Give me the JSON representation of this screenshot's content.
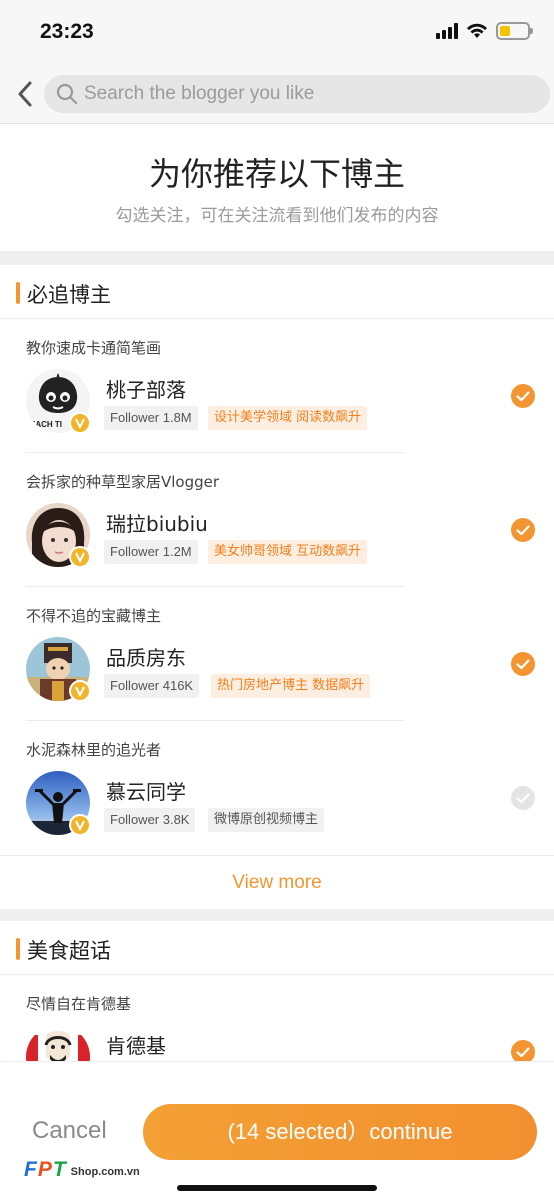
{
  "status_bar": {
    "time": "23:23"
  },
  "search": {
    "placeholder": "Search the blogger you like",
    "value": ""
  },
  "hero": {
    "title": "为你推荐以下博主",
    "subtitle": "勾选关注，可在关注流看到他们发布的内容"
  },
  "sections": [
    {
      "title": "必追博主",
      "bloggers": [
        {
          "desc": "教你速成卡通简笔画",
          "name": "桃子部落",
          "follower": "Follower 1.8M",
          "tag": "设计美学领域 阅读数飙升",
          "tag_style": "hot",
          "selected": true,
          "avatar_text": "EACH TI"
        },
        {
          "desc": "会拆家的种草型家居Vlogger",
          "name": "瑞拉biubiu",
          "follower": "Follower 1.2M",
          "tag": "美女帅哥领域 互动数飙升",
          "tag_style": "hot",
          "selected": true
        },
        {
          "desc": "不得不追的宝藏博主",
          "name": "品质房东",
          "follower": "Follower 416K",
          "tag": "热门房地产博主 数据飙升",
          "tag_style": "hot",
          "selected": true
        },
        {
          "desc": "水泥森林里的追光者",
          "name": "慕云同学",
          "follower": "Follower 3.8K",
          "tag": "微博原创视频博主",
          "tag_style": "plain",
          "selected": false
        }
      ],
      "view_more": "View more"
    },
    {
      "title": "美食超话",
      "bloggers": [
        {
          "desc": "尽情自在肯德基",
          "name": "肯德基",
          "selected": true
        }
      ]
    }
  ],
  "footer": {
    "cancel": "Cancel",
    "continue": "(14 selected）continue"
  },
  "watermark": {
    "brand": "FPT",
    "shop": "Shop.com.vn"
  },
  "colors": {
    "accent": "#f39530",
    "hot_tag_bg": "#fdeee2",
    "verified": "#f2b52a"
  }
}
